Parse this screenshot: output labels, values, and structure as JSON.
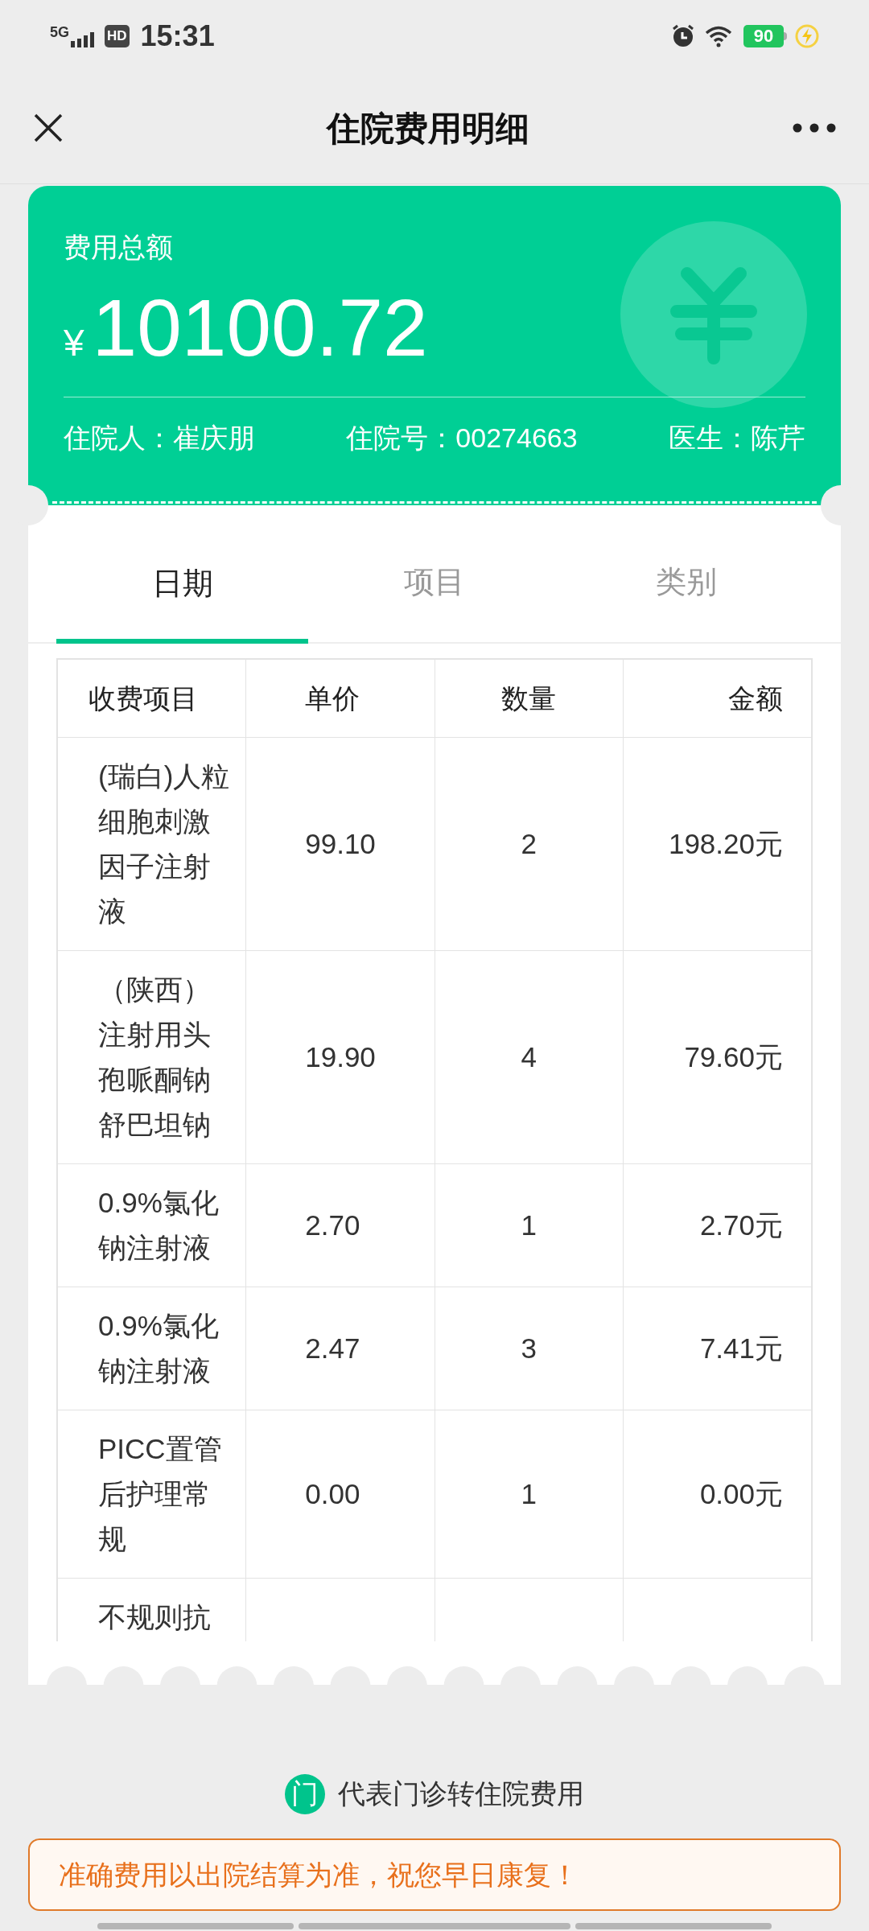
{
  "status_bar": {
    "network": "5G",
    "hd": "HD",
    "time": "15:31",
    "battery": "90"
  },
  "nav": {
    "title": "住院费用明细"
  },
  "summary": {
    "label": "费用总额",
    "currency": "¥",
    "amount": "10100.72",
    "fields": [
      {
        "text": "住院人：崔庆朋"
      },
      {
        "text": "住院号：00274663"
      },
      {
        "text": "医生：陈芹"
      }
    ]
  },
  "tabs": [
    {
      "label": "日期",
      "selected": true
    },
    {
      "label": "项目",
      "selected": false
    },
    {
      "label": "类别",
      "selected": false
    }
  ],
  "table": {
    "columns": [
      "收费项目",
      "单价",
      "数量",
      "金额"
    ],
    "rows": [
      {
        "cells": [
          "(瑞白)人粒细胞刺激因子注射液",
          "99.10",
          "2",
          "198.20元"
        ]
      },
      {
        "cells": [
          "（陕西）注射用头孢哌酮钠舒巴坦钠",
          "19.90",
          "4",
          "79.60元"
        ]
      },
      {
        "cells": [
          "0.9%氯化钠注射液",
          "2.70",
          "1",
          "2.70元"
        ]
      },
      {
        "cells": [
          "0.9%氯化钠注射液",
          "2.47",
          "3",
          "7.41元"
        ]
      },
      {
        "cells": [
          "PICC置管后护理常规",
          "0.00",
          "1",
          "0.00元"
        ]
      },
      {
        "cells": [
          "不规则抗"
        ]
      }
    ]
  },
  "legend": {
    "badge": "门",
    "text": "代表门诊转住院费用"
  },
  "notice": "准确费用以出院结算为准，祝您早日康复！"
}
